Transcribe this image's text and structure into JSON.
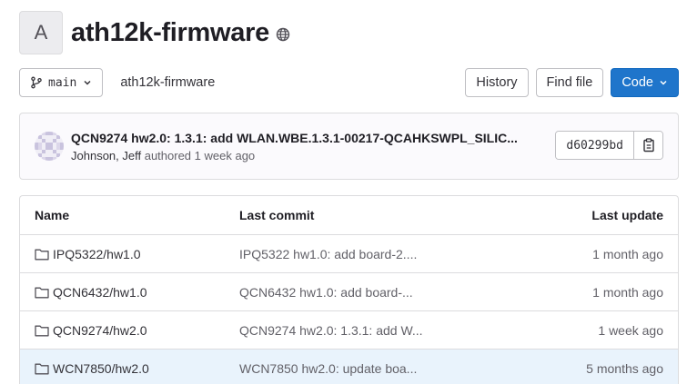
{
  "project": {
    "avatar_letter": "A",
    "name": "ath12k-firmware",
    "visibility_icon": "globe-icon"
  },
  "toolbar": {
    "branch_icon": "branch-icon",
    "branch": "main",
    "breadcrumb": "ath12k-firmware",
    "history_label": "History",
    "find_file_label": "Find file",
    "code_label": "Code"
  },
  "last_commit": {
    "title": "QCN9274 hw2.0: 1.3.1: add WLAN.WBE.1.3.1-00217-QCAHKSWPL_SILIC...",
    "author": "Johnson, Jeff",
    "authored_text": "authored",
    "time": "1 week ago",
    "sha": "d60299bd",
    "copy_icon": "clipboard-icon"
  },
  "tree": {
    "headers": {
      "name": "Name",
      "commit": "Last commit",
      "updated": "Last update"
    },
    "rows": [
      {
        "name": "IPQ5322/hw1.0",
        "commit": "IPQ5322 hw1.0: add board-2....",
        "updated": "1 month ago"
      },
      {
        "name": "QCN6432/hw1.0",
        "commit": "QCN6432 hw1.0: add board-...",
        "updated": "1 month ago"
      },
      {
        "name": "QCN9274/hw2.0",
        "commit": "QCN9274 hw2.0: 1.3.1: add W...",
        "updated": "1 week ago"
      },
      {
        "name": "WCN7850/hw2.0",
        "commit": "WCN7850 hw2.0: update boa...",
        "updated": "5 months ago"
      }
    ]
  },
  "colors": {
    "primary": "#1f75cb",
    "highlight_row": "#e9f3fc",
    "border": "#dcdcde"
  }
}
